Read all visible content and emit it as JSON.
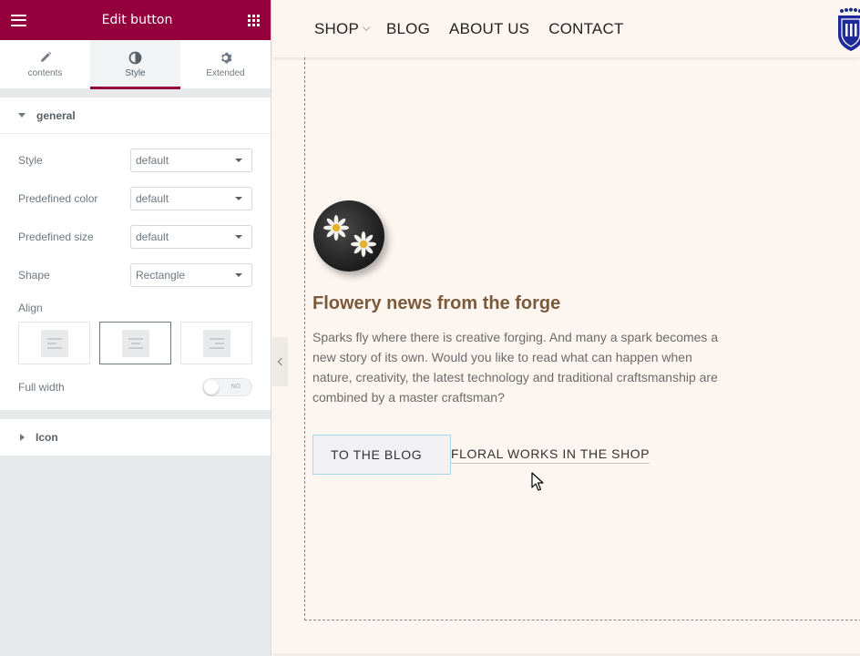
{
  "editor": {
    "title": "Edit button",
    "tabs": [
      {
        "label": "contents",
        "icon": "pencil-icon"
      },
      {
        "label": "Style",
        "icon": "half-circle-icon"
      },
      {
        "label": "Extended",
        "icon": "gear-icon"
      }
    ],
    "active_tab": "Style",
    "general": {
      "title": "general",
      "controls": [
        {
          "label": "Style",
          "value": "default"
        },
        {
          "label": "Predefined color",
          "value": "default"
        },
        {
          "label": "Predefined size",
          "value": "default"
        },
        {
          "label": "Shape",
          "value": "Rectangle"
        }
      ],
      "align_label": "Align",
      "align_options": [
        "align-left",
        "align-center",
        "align-right"
      ],
      "align_selected": "align-center",
      "full_width_label": "Full width",
      "full_width_toggle": "NO"
    },
    "icon_section": {
      "title": "Icon"
    },
    "accent_color": "#93003c"
  },
  "site": {
    "nav": [
      "SHOP",
      "BLOG",
      "ABOUT US",
      "CONTACT"
    ],
    "post": {
      "title": "Flowery news from the forge",
      "body": "Sparks fly where there is creative forging. And many a spark becomes a new story of its own. Would you like to read what can happen when nature, creativity, the latest technology and traditional craftsmanship are combined by a master craftsman?"
    },
    "buttons": {
      "primary": "TO THE BLOG",
      "secondary": "FLORAL WORKS IN THE SHOP"
    },
    "title_color": "#7b5a3c",
    "background": "#fdf6f0"
  }
}
